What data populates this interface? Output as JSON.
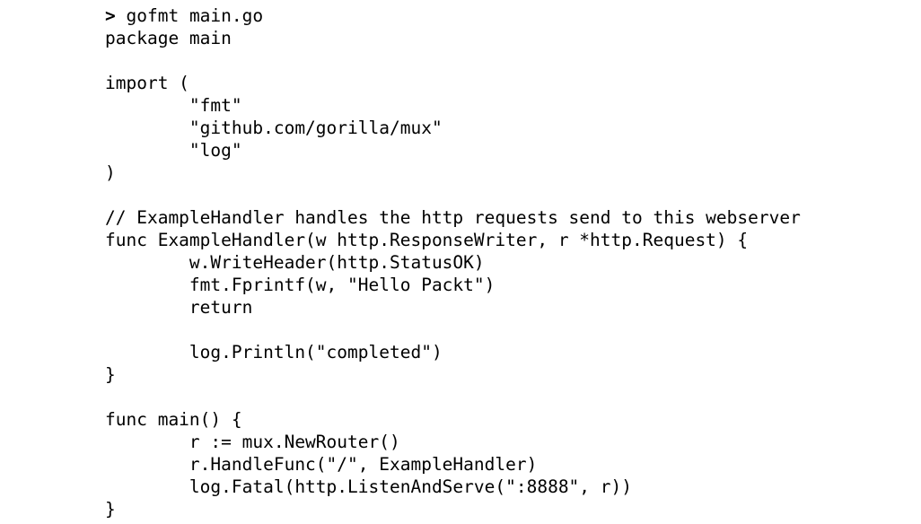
{
  "terminal": {
    "prompt_symbol": ">",
    "command": "gofmt main.go",
    "output_lines": [
      "package main",
      "",
      "import (",
      "        \"fmt\"",
      "        \"github.com/gorilla/mux\"",
      "        \"log\"",
      ")",
      "",
      "// ExampleHandler handles the http requests send to this webserver",
      "func ExampleHandler(w http.ResponseWriter, r *http.Request) {",
      "        w.WriteHeader(http.StatusOK)",
      "        fmt.Fprintf(w, \"Hello Packt\")",
      "        return",
      "",
      "        log.Println(\"completed\")",
      "}",
      "",
      "func main() {",
      "        r := mux.NewRouter()",
      "        r.HandleFunc(\"/\", ExampleHandler)",
      "        log.Fatal(http.ListenAndServe(\":8888\", r))",
      "}"
    ]
  }
}
